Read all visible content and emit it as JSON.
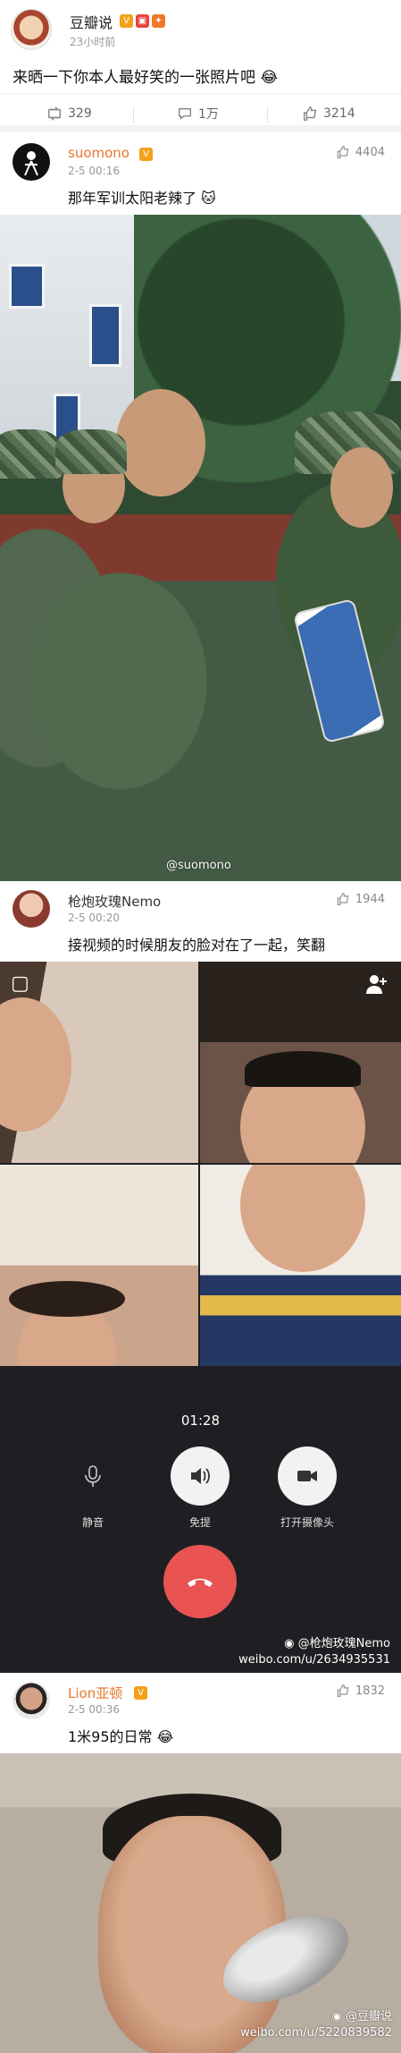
{
  "post": {
    "author": "豆瓣说",
    "time": "23小时前",
    "text": "来晒一下你本人最好笑的一张照片吧",
    "stats": {
      "reposts": "329",
      "comments": "1万",
      "likes": "3214"
    }
  },
  "comments": [
    {
      "user": "suomono",
      "time": "2-5 00:16",
      "likes": "4404",
      "text": "那年军训太阳老辣了"
    },
    {
      "user": "枪炮玫瑰Nemo",
      "time": "2-5 00:20",
      "likes": "1944",
      "text": "接视频的时候朋友的脸对在了一起，笑翻"
    },
    {
      "user": "Lion亚顿",
      "time": "2-5 00:36",
      "likes": "1832",
      "text": "1米95的日常"
    }
  ],
  "photo1": {
    "watermark": "@suomono"
  },
  "videocall": {
    "timer": "01:28",
    "controls": [
      "静音",
      "免提",
      "打开摄像头"
    ],
    "watermark_line1": "@枪炮玫瑰Nemo",
    "watermark_line2": "weibo.com/u/2634935531"
  },
  "photo2": {
    "watermark_line1": "@豆瓣说",
    "watermark_line2": "weibo.com/u/5220839582"
  },
  "colors": {
    "accent": "#e8762d",
    "hangup": "#e95352",
    "call_bg": "#1f1f23"
  }
}
